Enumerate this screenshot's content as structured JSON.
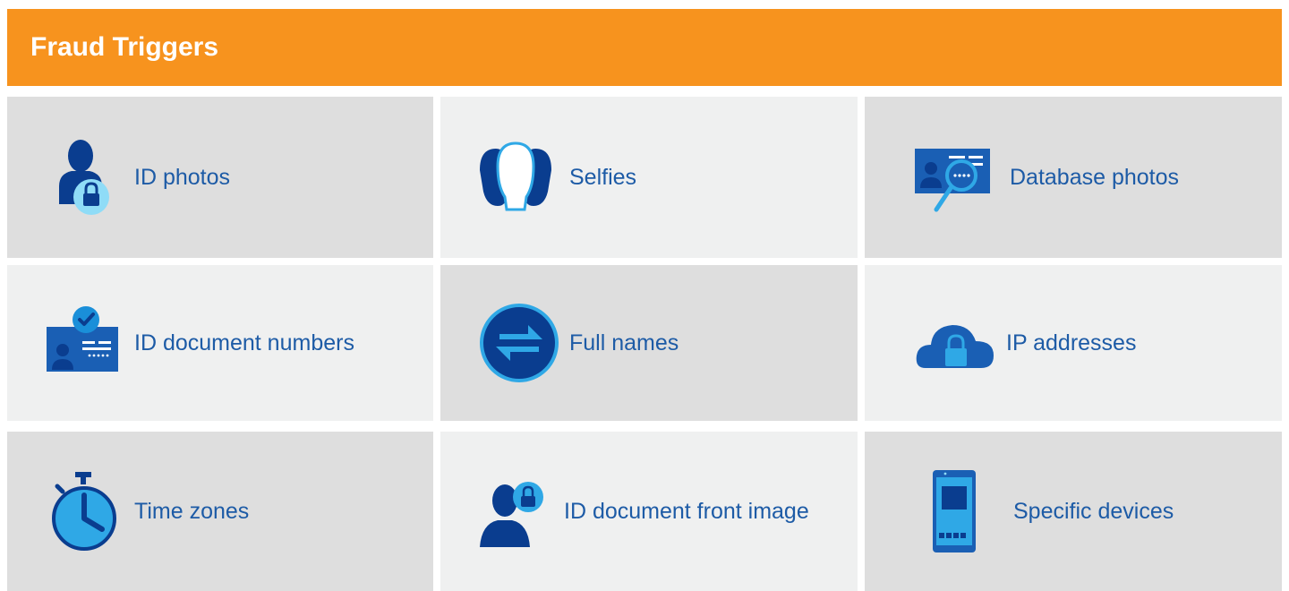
{
  "header": {
    "title": "Fraud Triggers"
  },
  "triggers": [
    {
      "label": "ID photos",
      "icon": "person-lock-icon"
    },
    {
      "label": "Selfies",
      "icon": "faces-icon"
    },
    {
      "label": "Database photos",
      "icon": "id-card-search-icon"
    },
    {
      "label": "ID document numbers",
      "icon": "id-card-check-icon"
    },
    {
      "label": "Full names",
      "icon": "swap-arrows-icon"
    },
    {
      "label": "IP addresses",
      "icon": "cloud-lock-icon"
    },
    {
      "label": "Time zones",
      "icon": "stopwatch-icon"
    },
    {
      "label": "ID document front image",
      "icon": "person-lock-badge-icon"
    },
    {
      "label": "Specific devices",
      "icon": "smartphone-icon"
    }
  ],
  "colors": {
    "header_bg": "#f7931e",
    "label": "#1d5ba6",
    "tile_dark": "#dedede",
    "tile_light": "#eff0f0",
    "icon_navy": "#0a3d8f",
    "icon_blue": "#1a5fb4",
    "icon_cyan": "#2fa8e6",
    "icon_light": "#8fdcf7"
  }
}
